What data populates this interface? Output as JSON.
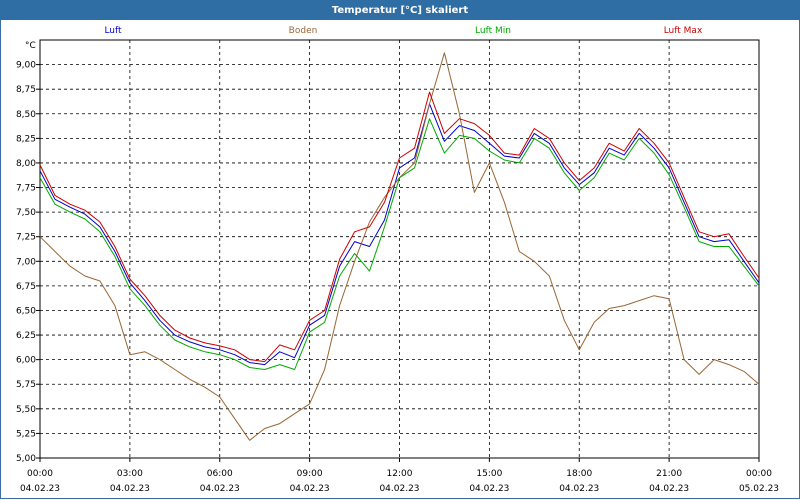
{
  "window": {
    "title": "Temperatur [°C] skaliert"
  },
  "chart_data": {
    "type": "line",
    "title": "Temperatur [°C] skaliert",
    "ylabel": "°C",
    "ylim": [
      5.0,
      9.25
    ],
    "yticks": [
      "5,00",
      "5,25",
      "5,50",
      "5,75",
      "6,00",
      "6,25",
      "6,50",
      "6,75",
      "7,00",
      "7,25",
      "7,50",
      "7,75",
      "8,00",
      "8,25",
      "8,50",
      "8,75",
      "9,00"
    ],
    "xlim_hours": [
      0,
      24
    ],
    "xticks": [
      {
        "time": "00:00",
        "date": "04.02.23"
      },
      {
        "time": "03:00",
        "date": "04.02.23"
      },
      {
        "time": "06:00",
        "date": "04.02.23"
      },
      {
        "time": "09:00",
        "date": "04.02.23"
      },
      {
        "time": "12:00",
        "date": "04.02.23"
      },
      {
        "time": "15:00",
        "date": "04.02.23"
      },
      {
        "time": "18:00",
        "date": "04.02.23"
      },
      {
        "time": "21:00",
        "date": "04.02.23"
      },
      {
        "time": "00:00",
        "date": "05.02.23"
      }
    ],
    "grid": true,
    "legend_position": "top",
    "series": [
      {
        "name": "Luft",
        "color": "#0000cc",
        "x": [
          0,
          0.5,
          1,
          1.5,
          2,
          2.5,
          3,
          3.5,
          4,
          4.5,
          5,
          5.5,
          6,
          6.5,
          7,
          7.5,
          8,
          8.5,
          9,
          9.5,
          10,
          10.5,
          11,
          11.5,
          12,
          12.5,
          13,
          13.5,
          14,
          14.5,
          15,
          15.5,
          16,
          16.5,
          17,
          17.5,
          18,
          18.5,
          19,
          19.5,
          20,
          20.5,
          21,
          21.5,
          22,
          22.5,
          23,
          23.5,
          24
        ],
        "y": [
          7.92,
          7.63,
          7.55,
          7.48,
          7.35,
          7.1,
          6.78,
          6.6,
          6.4,
          6.25,
          6.18,
          6.13,
          6.1,
          6.05,
          5.97,
          5.95,
          6.08,
          6.02,
          6.35,
          6.45,
          6.95,
          7.2,
          7.15,
          7.42,
          7.95,
          8.05,
          8.6,
          8.22,
          8.38,
          8.33,
          8.2,
          8.07,
          8.05,
          8.3,
          8.2,
          7.95,
          7.78,
          7.9,
          8.15,
          8.08,
          8.3,
          8.15,
          7.95,
          7.6,
          7.25,
          7.2,
          7.22,
          7.0,
          6.78
        ]
      },
      {
        "name": "Boden",
        "color": "#996633",
        "x": [
          0,
          0.5,
          1,
          1.5,
          2,
          2.5,
          3,
          3.5,
          4,
          4.5,
          5,
          5.5,
          6,
          6.5,
          7,
          7.5,
          8,
          8.5,
          9,
          9.5,
          10,
          10.5,
          11,
          11.5,
          12,
          12.5,
          13,
          13.5,
          14,
          14.5,
          15,
          15.5,
          16,
          16.5,
          17,
          17.5,
          18,
          18.5,
          19,
          19.5,
          20,
          20.5,
          21,
          21.5,
          22,
          22.5,
          23,
          23.5,
          24
        ],
        "y": [
          7.25,
          7.1,
          6.95,
          6.85,
          6.8,
          6.55,
          6.05,
          6.08,
          6.0,
          5.9,
          5.8,
          5.72,
          5.62,
          5.4,
          5.18,
          5.3,
          5.35,
          5.45,
          5.55,
          5.9,
          6.55,
          7.0,
          7.4,
          7.65,
          7.85,
          8.0,
          8.6,
          9.12,
          8.5,
          7.7,
          8.0,
          7.6,
          7.1,
          7.0,
          6.85,
          6.4,
          6.1,
          6.38,
          6.52,
          6.55,
          6.6,
          6.65,
          6.62,
          6.0,
          5.85,
          6.0,
          5.95,
          5.88,
          5.75
        ]
      },
      {
        "name": "Luft Min",
        "color": "#00aa00",
        "x": [
          0,
          0.5,
          1,
          1.5,
          2,
          2.5,
          3,
          3.5,
          4,
          4.5,
          5,
          5.5,
          6,
          6.5,
          7,
          7.5,
          8,
          8.5,
          9,
          9.5,
          10,
          10.5,
          11,
          11.5,
          12,
          12.5,
          13,
          13.5,
          14,
          14.5,
          15,
          15.5,
          16,
          16.5,
          17,
          17.5,
          18,
          18.5,
          19,
          19.5,
          20,
          20.5,
          21,
          21.5,
          22,
          22.5,
          23,
          23.5,
          24
        ],
        "y": [
          7.85,
          7.58,
          7.5,
          7.43,
          7.3,
          7.05,
          6.72,
          6.55,
          6.35,
          6.2,
          6.13,
          6.08,
          6.05,
          6.0,
          5.92,
          5.9,
          5.95,
          5.9,
          6.28,
          6.38,
          6.85,
          7.08,
          6.9,
          7.35,
          7.85,
          7.95,
          8.45,
          8.1,
          8.28,
          8.25,
          8.12,
          8.03,
          8.0,
          8.25,
          8.15,
          7.9,
          7.72,
          7.85,
          8.1,
          8.03,
          8.25,
          8.1,
          7.88,
          7.55,
          7.2,
          7.15,
          7.15,
          6.95,
          6.75
        ]
      },
      {
        "name": "Luft Max",
        "color": "#cc0000",
        "x": [
          0,
          0.5,
          1,
          1.5,
          2,
          2.5,
          3,
          3.5,
          4,
          4.5,
          5,
          5.5,
          6,
          6.5,
          7,
          7.5,
          8,
          8.5,
          9,
          9.5,
          10,
          10.5,
          11,
          11.5,
          12,
          12.5,
          13,
          13.5,
          14,
          14.5,
          15,
          15.5,
          16,
          16.5,
          17,
          17.5,
          18,
          18.5,
          19,
          19.5,
          20,
          20.5,
          21,
          21.5,
          22,
          22.5,
          23,
          23.5,
          24
        ],
        "y": [
          7.98,
          7.67,
          7.58,
          7.52,
          7.4,
          7.15,
          6.82,
          6.65,
          6.45,
          6.3,
          6.22,
          6.17,
          6.14,
          6.1,
          6.0,
          5.98,
          6.15,
          6.1,
          6.4,
          6.5,
          7.02,
          7.3,
          7.35,
          7.6,
          8.05,
          8.15,
          8.72,
          8.3,
          8.45,
          8.4,
          8.28,
          8.1,
          8.08,
          8.35,
          8.25,
          8.0,
          7.82,
          7.95,
          8.2,
          8.12,
          8.35,
          8.2,
          8.0,
          7.65,
          7.3,
          7.25,
          7.28,
          7.05,
          6.83
        ]
      }
    ]
  }
}
